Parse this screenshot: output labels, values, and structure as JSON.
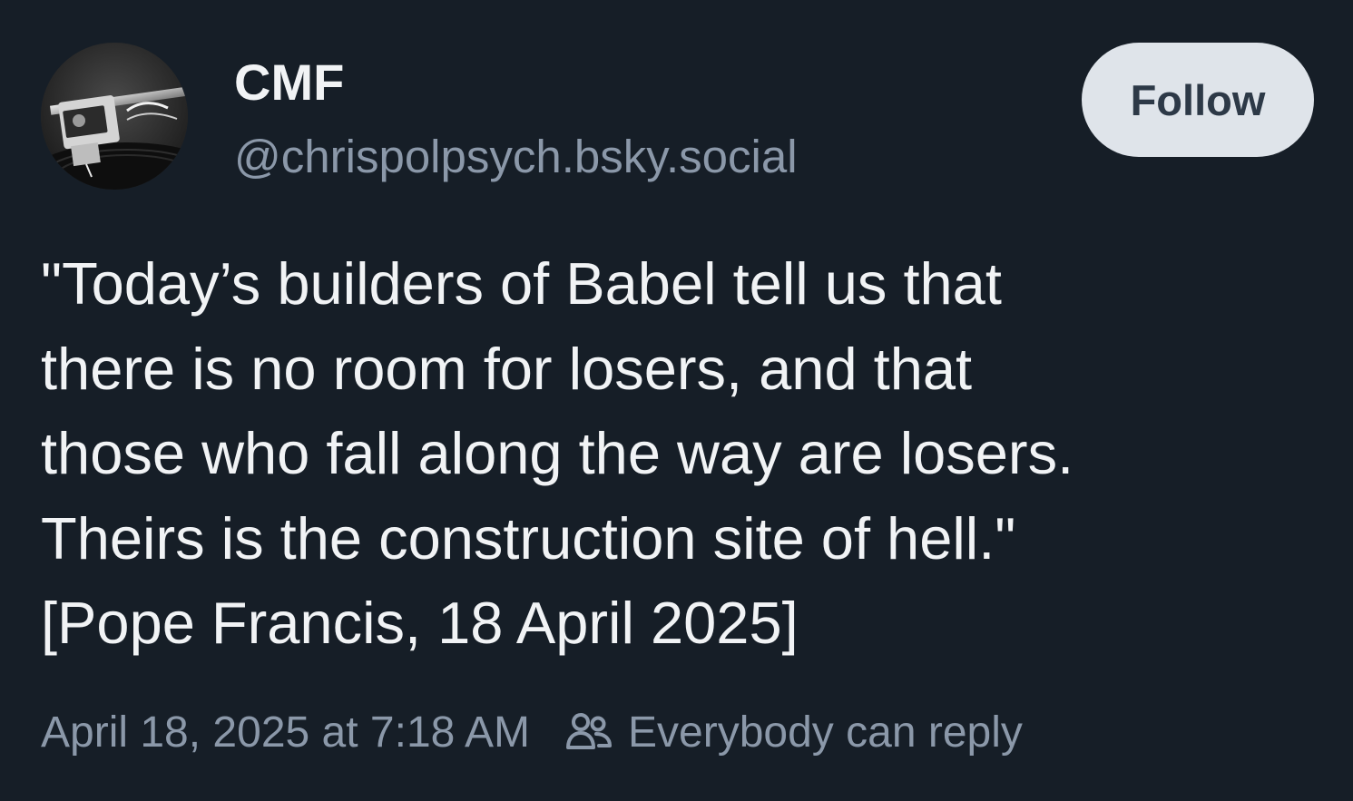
{
  "post": {
    "author": {
      "display_name": "CMF",
      "handle": "@chrispolpsych.bsky.social",
      "avatar_icon": "turntable-cartridge-avatar"
    },
    "follow_label": "Follow",
    "text_lines": [
      "\"Today’s builders of Babel tell us that",
      "there is no room for losers, and that",
      "those who fall along the way are losers.",
      "Theirs is the construction site of hell.\"",
      "[Pope Francis, 18 April 2025]"
    ],
    "timestamp": "April 18, 2025 at 7:18 AM",
    "reply_setting": {
      "icon": "people-icon",
      "label": "Everybody can reply"
    }
  },
  "colors": {
    "background": "#161e27",
    "text_primary": "#f1f3f5",
    "text_secondary": "#8b98a9",
    "follow_button_bg": "#dfe4ea",
    "follow_button_text": "#2d3947"
  }
}
